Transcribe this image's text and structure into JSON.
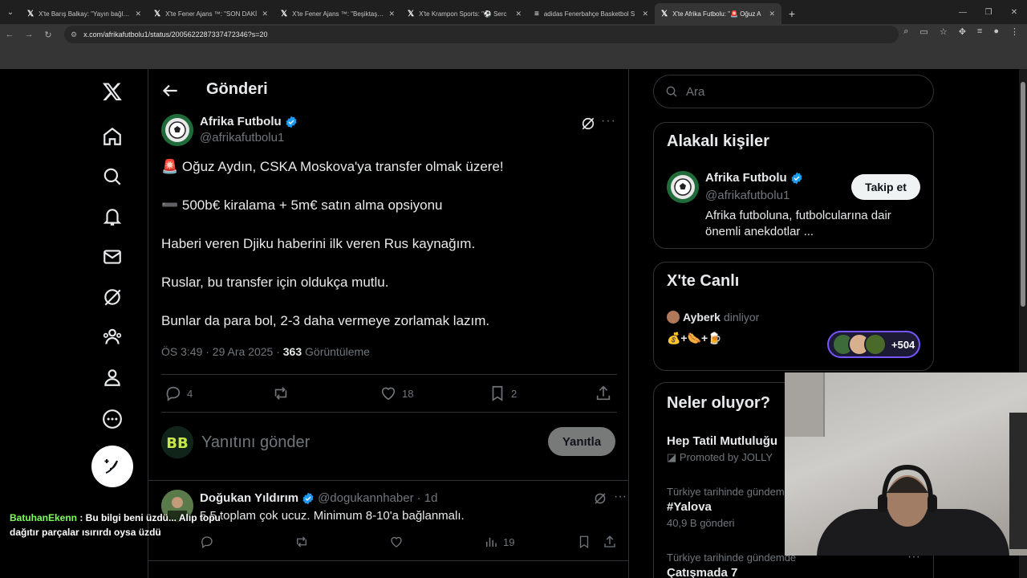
{
  "browser": {
    "tabs": [
      {
        "title": "X'te Barış Balkay: \"Yayın bağladı"
      },
      {
        "title": "X'te Fener Ajans ™: \"SON DAKİ"
      },
      {
        "title": "X'te Fener Ajans ™: \"Beşiktaş, T"
      },
      {
        "title": "X'te Krampon Sports: \"⚽ Serc"
      },
      {
        "title": "adidas Fenerbahçe Basketbol S"
      },
      {
        "title": "X'te Afrika Futbolu: \"🚨 Oğuz A"
      }
    ],
    "url": "x.com/afrikafutbolu1/status/2005622287337472346?s=20"
  },
  "header": {
    "title": "Gönderi"
  },
  "tweet": {
    "name": "Afrika Futbolu",
    "handle": "@afrikafutbolu1",
    "lines": [
      "🚨 Oğuz Aydın, CSKA Moskova'ya transfer olmak üzere!",
      "➖ 500b€ kiralama + 5m€ satın alma opsiyonu",
      "Haberi veren Djiku haberini ilk veren Rus kaynağım.",
      "Ruslar, bu transfer için oldukça mutlu.",
      "Bunlar da para bol, 2-3 daha vermeye zorlamak lazım."
    ],
    "time": "ÖS 3:49 · 29 Ara 2025 · ",
    "views": "363",
    "views_label": " Görüntüleme",
    "replies": "4",
    "likes": "18",
    "bookmarks": "2"
  },
  "reply_box": {
    "placeholder": "Yanıtını gönder",
    "button": "Yanıtla"
  },
  "comment": {
    "name": "Doğukan Yıldırım",
    "handle": "@dogukannhaber",
    "time": "· 1d",
    "text": "5.5 toplam çok ucuz. Minimum 8-10'a bağlanmalı.",
    "views": "19"
  },
  "sidebar": {
    "search_placeholder": "Ara",
    "related_title": "Alakalı kişiler",
    "related": {
      "name": "Afrika Futbolu",
      "handle": "@afrikafutbolu1",
      "bio": "Afrika futboluna, futbolcularına dair önemli anekdotlar ...",
      "follow": "Takip et"
    },
    "live_title": "X'te Canlı",
    "live": {
      "user": "Ayberk",
      "status": "dinliyor",
      "emojis": "💰+🌭+🍺",
      "count": "+504"
    },
    "trends_title": "Neler oluyor?",
    "trends": [
      {
        "t1": "",
        "t2": "Hep Tatil Mutluluğu",
        "t3": "Promoted by JOLLY"
      },
      {
        "t1": "Türkiye tarihinde gündem",
        "t2": "#Yalova",
        "t3": "40,9 B gönderi"
      },
      {
        "t1": "Türkiye tarihinde gündemde",
        "t2": "Çatışmada 7",
        "t3": ""
      }
    ]
  },
  "chat": {
    "user": "BatuhanEkenn",
    "line1": " : Bu bilgi beni üzdü... Alıp topu",
    "line2": "dağıtır parçalar ısırırdı oysa üzdü"
  },
  "colors": {
    "accent": "#1d9bf0",
    "background": "#000000",
    "border": "#2f3336",
    "muted": "#71767b"
  }
}
